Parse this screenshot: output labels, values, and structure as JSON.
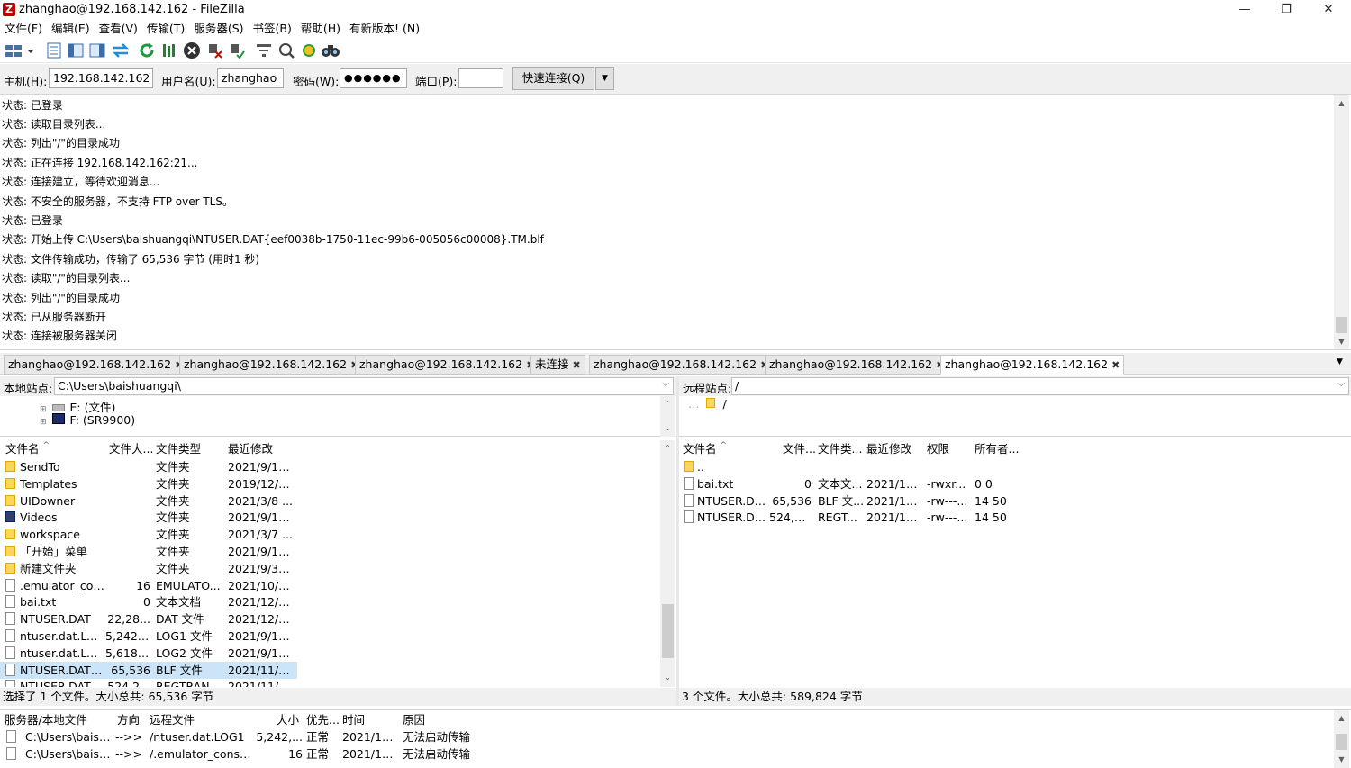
{
  "window": {
    "title": "zhanghao@192.168.142.162 - FileZilla",
    "logo": "Z",
    "minimize": "—",
    "restore": "❐",
    "close": "✕"
  },
  "menu": [
    "文件(F)",
    "编辑(E)",
    "查看(V)",
    "传输(T)",
    "服务器(S)",
    "书签(B)",
    "帮助(H)",
    "有新版本! (N)"
  ],
  "quickconnect": {
    "host_label": "主机(H):",
    "host": "192.168.142.162",
    "user_label": "用户名(U):",
    "user": "zhanghao",
    "pass_label": "密码(W):",
    "pass": "●●●●●●",
    "port_label": "端口(P):",
    "port": "",
    "connect_label": "快速连接(Q)"
  },
  "log": [
    "状态: 已登录",
    "状态: 读取目录列表...",
    "状态: 列出\"/\"的目录成功",
    "状态: 正在连接 192.168.142.162:21...",
    "状态: 连接建立，等待欢迎消息...",
    "状态: 不安全的服务器，不支持 FTP over TLS。",
    "状态: 已登录",
    "状态: 开始上传 C:\\Users\\baishuangqi\\NTUSER.DAT{eef0038b-1750-11ec-99b6-005056c00008}.TM.blf",
    "状态: 文件传输成功，传输了 65,536 字节 (用时1 秒)",
    "状态: 读取\"/\"的目录列表...",
    "状态: 列出\"/\"的目录成功",
    "状态: 已从服务器断开",
    "状态: 连接被服务器关闭"
  ],
  "tabs": [
    {
      "label": "zhanghao@192.168.142.162"
    },
    {
      "label": "zhanghao@192.168.142.162"
    },
    {
      "label": "zhanghao@192.168.142.162"
    },
    {
      "label": "未连接"
    },
    {
      "label": "zhanghao@192.168.142.162"
    },
    {
      "label": "zhanghao@192.168.142.162"
    },
    {
      "label": "zhanghao@192.168.142.162"
    }
  ],
  "local": {
    "site_label": "本地站点:",
    "path": "C:\\Users\\baishuangqi\\",
    "tree": [
      "E: (文件)",
      "F: (SR9900)"
    ],
    "headers": [
      "文件名",
      "文件大...",
      "文件类型",
      "最近修改"
    ],
    "files": [
      {
        "name": "SendTo",
        "size": "",
        "type": "文件夹",
        "modified": "2021/9/17...",
        "icon": "folder"
      },
      {
        "name": "Templates",
        "size": "",
        "type": "文件夹",
        "modified": "2019/12/7...",
        "icon": "folder"
      },
      {
        "name": "UIDowner",
        "size": "",
        "type": "文件夹",
        "modified": "2021/3/8 ...",
        "icon": "folder"
      },
      {
        "name": "Videos",
        "size": "",
        "type": "文件夹",
        "modified": "2021/9/17...",
        "icon": "videos"
      },
      {
        "name": "workspace",
        "size": "",
        "type": "文件夹",
        "modified": "2021/3/7 ...",
        "icon": "folder"
      },
      {
        "name": "「开始」菜单",
        "size": "",
        "type": "文件夹",
        "modified": "2021/9/17...",
        "icon": "folder"
      },
      {
        "name": "新建文件夹",
        "size": "",
        "type": "文件夹",
        "modified": "2021/9/30...",
        "icon": "folder"
      },
      {
        "name": ".emulator_con...",
        "size": "16",
        "type": "EMULATO...",
        "modified": "2021/10/1...",
        "icon": "file"
      },
      {
        "name": "bai.txt",
        "size": "0",
        "type": "文本文档",
        "modified": "2021/12/1...",
        "icon": "file"
      },
      {
        "name": "NTUSER.DAT",
        "size": "22,28...",
        "type": "DAT 文件",
        "modified": "2021/12/1...",
        "icon": "file"
      },
      {
        "name": "ntuser.dat.LO...",
        "size": "5,242,...",
        "type": "LOG1 文件",
        "modified": "2021/9/17...",
        "icon": "file"
      },
      {
        "name": "ntuser.dat.LO...",
        "size": "5,618,...",
        "type": "LOG2 文件",
        "modified": "2021/9/17...",
        "icon": "file"
      },
      {
        "name": "NTUSER.DAT{...",
        "size": "65,536",
        "type": "BLF 文件",
        "modified": "2021/11/2...",
        "icon": "file",
        "selected": true
      },
      {
        "name": "NTUSER.DAT{...",
        "size": "524,2...",
        "type": "REGTRANS...",
        "modified": "2021/11/2...",
        "icon": "file"
      }
    ],
    "status": "选择了 1 个文件。大小总共: 65,536 字节"
  },
  "remote": {
    "site_label": "远程站点:",
    "path": "/",
    "tree": [
      "/"
    ],
    "headers": [
      "文件名",
      "文件...",
      "文件类...",
      "最近修改",
      "权限",
      "所有者..."
    ],
    "files": [
      {
        "name": "..",
        "size": "",
        "type": "",
        "modified": "",
        "perm": "",
        "owner": "",
        "icon": "folder"
      },
      {
        "name": "bai.txt",
        "size": "0",
        "type": "文本文...",
        "modified": "2021/12...",
        "perm": "-rwxr...",
        "owner": "0 0",
        "icon": "file"
      },
      {
        "name": "NTUSER.DA...",
        "size": "65,536",
        "type": "BLF 文...",
        "modified": "2021/12...",
        "perm": "-rw---...",
        "owner": "14 50",
        "icon": "file"
      },
      {
        "name": "NTUSER.DA...",
        "size": "524,2...",
        "type": "REGT...",
        "modified": "2021/12...",
        "perm": "-rw---...",
        "owner": "14 50",
        "icon": "file"
      }
    ],
    "status": "3 个文件。大小总共: 589,824 字节"
  },
  "queue": {
    "headers": [
      "服务器/本地文件",
      "方向",
      "远程文件",
      "大小",
      "优先...",
      "时间",
      "原因"
    ],
    "rows": [
      {
        "local": "C:\\Users\\baish...",
        "dir": "-->>",
        "remote": "/ntuser.dat.LOG1",
        "size": "5,242,...",
        "priority": "正常",
        "time": "2021/12...",
        "reason": "无法启动传输"
      },
      {
        "local": "C:\\Users\\baish...",
        "dir": "-->>",
        "remote": "/.emulator_consol...",
        "size": "16",
        "priority": "正常",
        "time": "2021/12...",
        "reason": "无法启动传输"
      }
    ]
  }
}
